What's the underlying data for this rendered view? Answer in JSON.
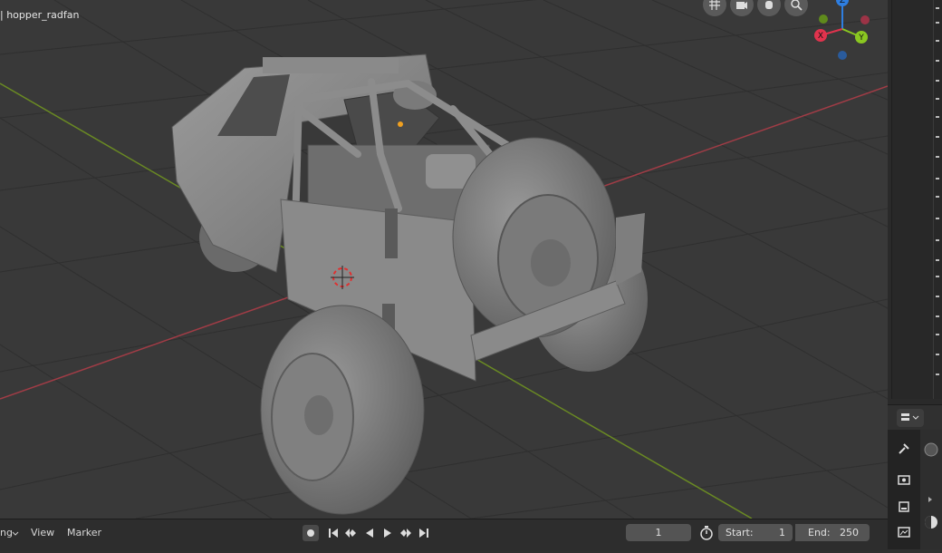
{
  "viewport": {
    "object_name": "| hopper_radfan",
    "nav_buttons": [
      "grid-icon",
      "camera-icon",
      "hand-icon",
      "zoom-icon"
    ],
    "gizmo": {
      "z_label": "Z",
      "x_label": "X",
      "y_label": "Y",
      "colors": {
        "x": "#e1334d",
        "y": "#8ac721",
        "z": "#2e7ee0",
        "neg_x": "#9c3346",
        "neg_y": "#5f8a1c",
        "neg_z": "#2a5b9c"
      }
    },
    "axis_colors": {
      "x_line": "#a03c46",
      "y_line": "#6a8a23"
    }
  },
  "timeline": {
    "menu_partial": "ng",
    "view_label": "View",
    "marker_label": "Marker",
    "current_frame": "1",
    "start_label": "Start:",
    "start_value": "1",
    "end_label": "End:",
    "end_value": "250"
  },
  "properties": {
    "tabs": [
      "tool-icon",
      "render-icon",
      "output-icon",
      "view-layer-icon"
    ]
  }
}
